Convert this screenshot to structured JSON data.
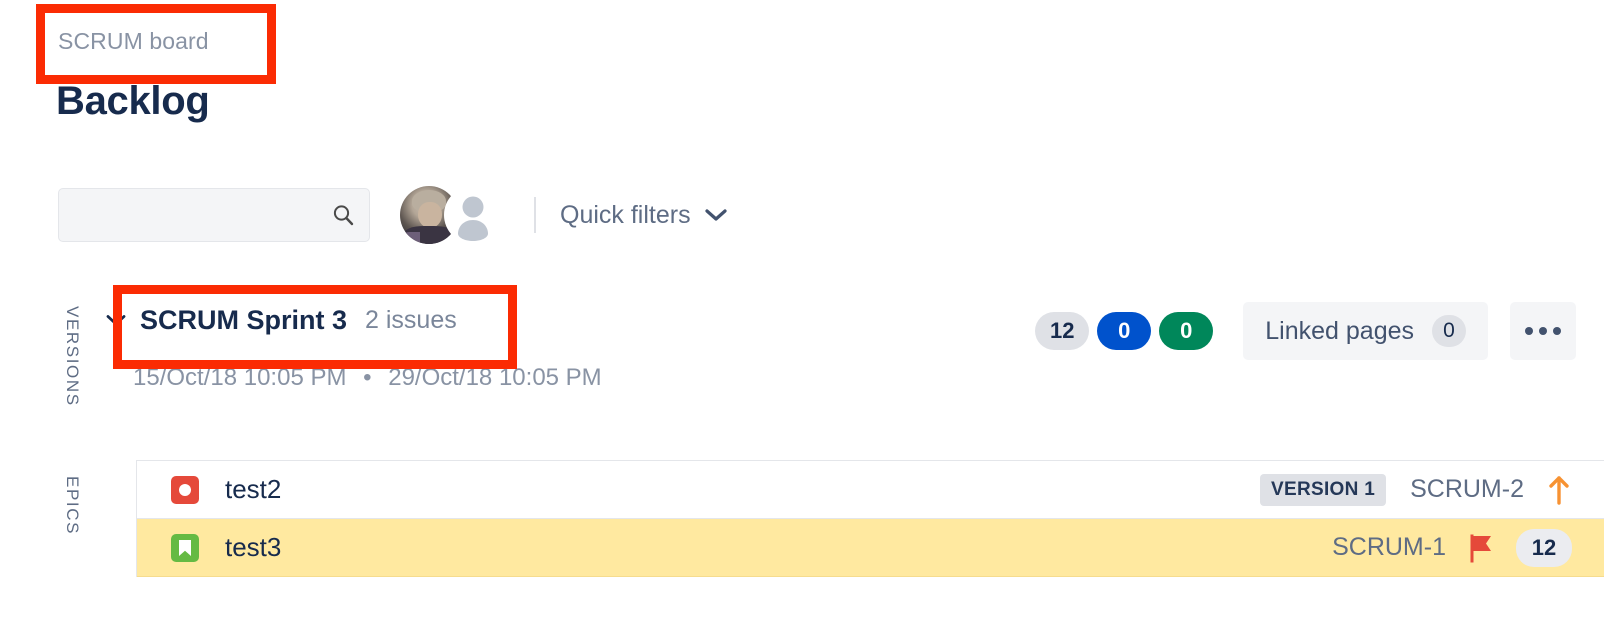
{
  "breadcrumb": {
    "label": "SCRUM board"
  },
  "page": {
    "title": "Backlog"
  },
  "toolbar": {
    "search": {
      "value": "",
      "placeholder": ""
    },
    "search_icon": "search-icon",
    "avatars": [
      {
        "name": "user-avatar-photo",
        "type": "photo"
      },
      {
        "name": "user-avatar-default",
        "type": "default-person"
      }
    ],
    "quick_filters": {
      "label": "Quick filters",
      "chevron": "chevron-down-icon"
    }
  },
  "side_rail": {
    "versions_label": "VERSIONS",
    "epics_label": "EPICS"
  },
  "sprint": {
    "toggle_icon": "chevron-down-icon",
    "name": "SCRUM Sprint 3",
    "issue_count_label": "2 issues",
    "start_date": "15/Oct/18 10:05 PM",
    "date_separator": "•",
    "end_date": "29/Oct/18 10:05 PM",
    "status_counts": [
      {
        "label": "12",
        "color": "#DFE1E6",
        "kind": "todo"
      },
      {
        "label": "0",
        "color": "#0052CC",
        "kind": "in-progress"
      },
      {
        "label": "0",
        "color": "#00875A",
        "kind": "done"
      }
    ],
    "linked_pages": {
      "label": "Linked pages",
      "count": "0"
    },
    "more_button": "more-options-icon"
  },
  "issues": [
    {
      "type_icon": "bug-icon",
      "type_color": "#E5493A",
      "summary": "test2",
      "version": "VERSION 1",
      "key": "SCRUM-2",
      "priority_icon": "priority-high-arrow-up-icon",
      "priority_color": "#F79232",
      "estimate": "",
      "selected": false
    },
    {
      "type_icon": "story-icon",
      "type_color": "#65BA43",
      "summary": "test3",
      "version": "",
      "key": "SCRUM-1",
      "priority_icon": "priority-highest-flag-icon",
      "priority_color": "#E5493A",
      "estimate": "12",
      "selected": true
    }
  ],
  "annotations": [
    {
      "name": "highlight-breadcrumb",
      "color": "#FB2B03"
    },
    {
      "name": "highlight-sprint-name",
      "color": "#FB2B03"
    }
  ]
}
